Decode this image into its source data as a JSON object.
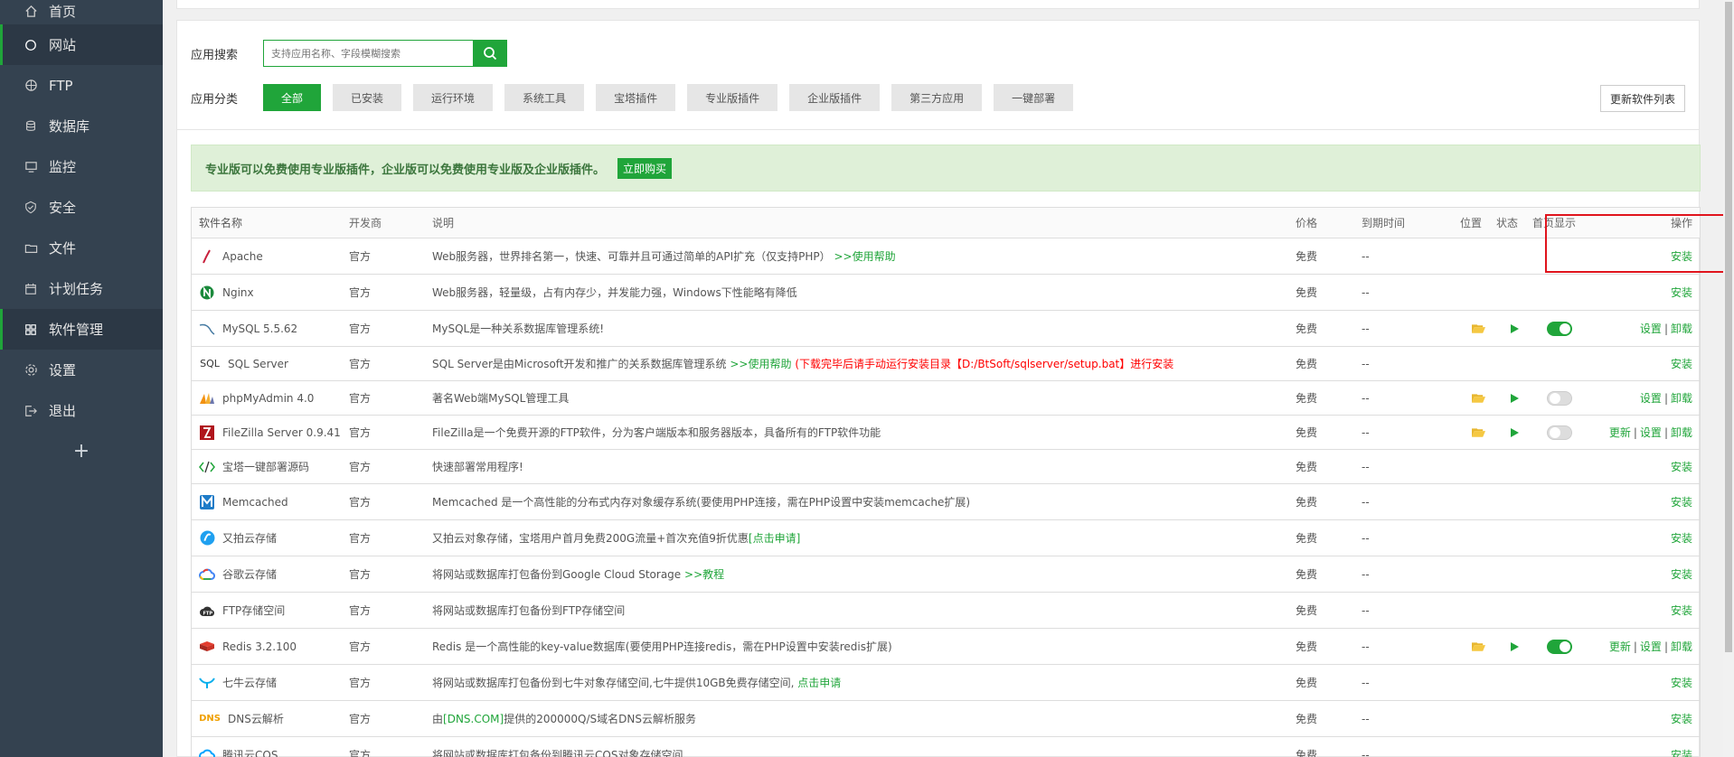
{
  "sidebar": {
    "items": [
      {
        "label": "首页",
        "icon": "home-icon"
      },
      {
        "label": "网站",
        "icon": "globe-icon"
      },
      {
        "label": "FTP",
        "icon": "ftp-icon"
      },
      {
        "label": "数据库",
        "icon": "database-icon"
      },
      {
        "label": "监控",
        "icon": "monitor-icon"
      },
      {
        "label": "安全",
        "icon": "shield-icon"
      },
      {
        "label": "文件",
        "icon": "folder-icon"
      },
      {
        "label": "计划任务",
        "icon": "calendar-icon"
      },
      {
        "label": "软件管理",
        "icon": "grid-icon"
      },
      {
        "label": "设置",
        "icon": "gear-icon"
      },
      {
        "label": "退出",
        "icon": "logout-icon"
      }
    ],
    "add_label": "+"
  },
  "search": {
    "label": "应用搜索",
    "placeholder": "支持应用名称、字段模糊搜索"
  },
  "categories": {
    "label": "应用分类",
    "items": [
      "全部",
      "已安装",
      "运行环境",
      "系统工具",
      "宝塔插件",
      "专业版插件",
      "企业版插件",
      "第三方应用",
      "一键部署"
    ],
    "refresh_label": "更新软件列表"
  },
  "notice": {
    "text": "专业版可以免费使用专业版插件，企业版可以免费使用专业版及企业版插件。",
    "buy_label": "立即购买"
  },
  "table": {
    "headers": {
      "name": "软件名称",
      "dev": "开发商",
      "desc": "说明",
      "price": "价格",
      "expire": "到期时间",
      "pos": "位置",
      "state": "状态",
      "home": "首页显示",
      "op": "操作"
    },
    "rows": [
      {
        "name": "Apache",
        "dev": "官方",
        "desc": "Web服务器，世界排名第一，快速、可靠并且可通过简单的API扩充（仅支持PHP）",
        "desc_link": ">>使用帮助",
        "desc_red": "",
        "price": "免费",
        "expire": "--",
        "op": [
          "安装"
        ]
      },
      {
        "name": "Nginx",
        "dev": "官方",
        "desc": "Web服务器，轻量级，占有内存少，并发能力强，Windows下性能略有降低",
        "desc_link": "",
        "desc_red": "",
        "price": "免费",
        "expire": "--",
        "op": [
          "安装"
        ]
      },
      {
        "name": "MySQL 5.5.62",
        "dev": "官方",
        "desc": "MySQL是一种关系数据库管理系统!",
        "desc_link": "",
        "desc_red": "",
        "price": "免费",
        "expire": "--",
        "op": [
          "设置",
          "卸载"
        ]
      },
      {
        "name": "SQL Server",
        "dev": "官方",
        "desc": "SQL Server是由Microsoft开发和推广的关系数据库管理系统",
        "desc_link": ">>使用帮助",
        "desc_red": "(下载完毕后请手动运行安装目录【D:/BtSoft/sqlserver/setup.bat】进行安装",
        "price": "免费",
        "expire": "--",
        "op": [
          "安装"
        ]
      },
      {
        "name": "phpMyAdmin 4.0",
        "dev": "官方",
        "desc": "著名Web端MySQL管理工具",
        "desc_link": "",
        "desc_red": "",
        "price": "免费",
        "expire": "--",
        "op": [
          "设置",
          "卸载"
        ]
      },
      {
        "name": "FileZilla Server 0.9.41",
        "dev": "官方",
        "desc": "FileZilla是一个免费开源的FTP软件，分为客户端版本和服务器版本，具备所有的FTP软件功能",
        "desc_link": "",
        "desc_red": "",
        "price": "免费",
        "expire": "--",
        "op": [
          "更新",
          "设置",
          "卸载"
        ]
      },
      {
        "name": "宝塔一键部署源码",
        "dev": "官方",
        "desc": "快速部署常用程序!",
        "desc_link": "",
        "desc_red": "",
        "price": "免费",
        "expire": "--",
        "op": [
          "安装"
        ]
      },
      {
        "name": "Memcached",
        "dev": "官方",
        "desc": "Memcached 是一个高性能的分布式内存对象缓存系统(要使用PHP连接，需在PHP设置中安装memcache扩展)",
        "desc_link": "",
        "desc_red": "",
        "price": "免费",
        "expire": "--",
        "op": [
          "安装"
        ]
      },
      {
        "name": "又拍云存储",
        "dev": "官方",
        "desc": "又拍云对象存储，宝塔用户首月免费200G流量+首次充值9折优惠",
        "desc_link": "[点击申请]",
        "desc_red": "",
        "price": "免费",
        "expire": "--",
        "op": [
          "安装"
        ]
      },
      {
        "name": "谷歌云存储",
        "dev": "官方",
        "desc": "将网站或数据库打包备份到Google Cloud Storage",
        "desc_link": ">>教程",
        "desc_red": "",
        "price": "免费",
        "expire": "--",
        "op": [
          "安装"
        ]
      },
      {
        "name": "FTP存储空间",
        "dev": "官方",
        "desc": "将网站或数据库打包备份到FTP存储空间",
        "desc_link": "",
        "desc_red": "",
        "price": "免费",
        "expire": "--",
        "op": [
          "安装"
        ]
      },
      {
        "name": "Redis 3.2.100",
        "dev": "官方",
        "desc": "Redis 是一个高性能的key-value数据库(要使用PHP连接redis，需在PHP设置中安装redis扩展)",
        "desc_link": "",
        "desc_red": "",
        "price": "免费",
        "expire": "--",
        "op": [
          "更新",
          "设置",
          "卸载"
        ]
      },
      {
        "name": "七牛云存储",
        "dev": "官方",
        "desc": "将网站或数据库打包备份到七牛对象存储空间,七牛提供10GB免费存储空间,",
        "desc_link": "点击申请",
        "desc_red": "",
        "price": "免费",
        "expire": "--",
        "op": [
          "安装"
        ]
      },
      {
        "name": "DNS云解析",
        "dev": "官方",
        "desc": "由",
        "desc_link": "[DNS.COM]",
        "desc_tail": "提供的200000Q/S域名DNS云解析服务",
        "desc_red": "",
        "price": "免费",
        "expire": "--",
        "op": [
          "安装"
        ]
      },
      {
        "name": "腾讯云COS",
        "dev": "官方",
        "desc": "将网站或数据库打包备份到腾讯云COS对象存储空间",
        "desc_link": "",
        "desc_red": "",
        "price": "免费",
        "expire": "--",
        "op": [
          "安装"
        ]
      }
    ]
  }
}
